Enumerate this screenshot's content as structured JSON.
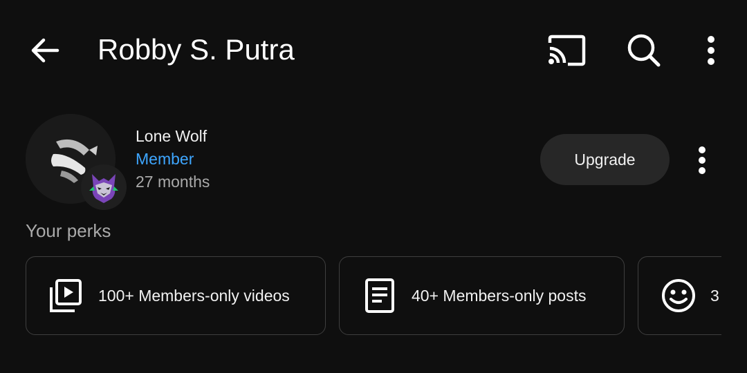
{
  "header": {
    "title": "Robby S. Putra",
    "icons": [
      "back-arrow-icon",
      "cast-icon",
      "search-icon",
      "more-vert-icon"
    ]
  },
  "membership": {
    "name": "Lone Wolf",
    "status": "Member",
    "duration": "27 months",
    "upgrade_label": "Upgrade"
  },
  "perks": {
    "section_label": "Your perks",
    "items": [
      {
        "label": "100+ Members-only videos",
        "icon": "video-library-icon"
      },
      {
        "label": "40+ Members-only posts",
        "icon": "document-icon"
      },
      {
        "label": "3",
        "icon": "smiley-face-icon"
      }
    ]
  },
  "colors": {
    "background": "#0f0f0f",
    "member_status": "#3ea6ff",
    "secondary_text": "#aaaaaa",
    "button_bg": "#272727",
    "card_border": "#3f3f3f"
  }
}
